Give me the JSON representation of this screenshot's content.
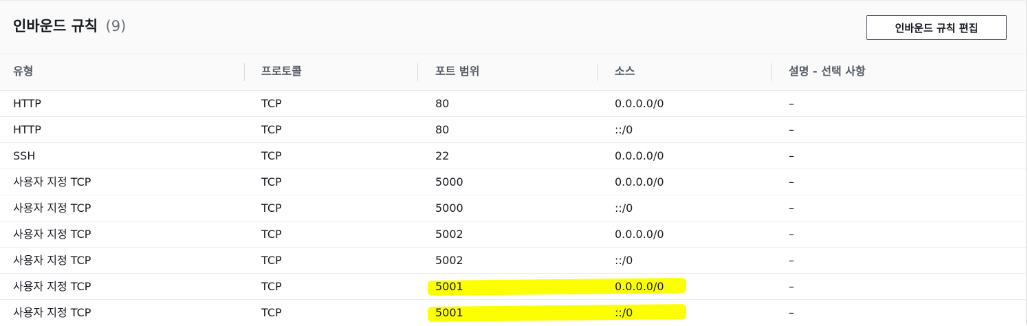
{
  "header": {
    "title": "인바운드 규칙",
    "count": "(9)",
    "edit_button_label": "인바운드 규칙 편집"
  },
  "table": {
    "columns": [
      "유형",
      "프로토콜",
      "포트 범위",
      "소스",
      "설명 - 선택 사항"
    ],
    "rows": [
      {
        "type": "HTTP",
        "protocol": "TCP",
        "port": "80",
        "source": "0.0.0.0/0",
        "description": "–",
        "highlighted": false
      },
      {
        "type": "HTTP",
        "protocol": "TCP",
        "port": "80",
        "source": "::/0",
        "description": "–",
        "highlighted": false
      },
      {
        "type": "SSH",
        "protocol": "TCP",
        "port": "22",
        "source": "0.0.0.0/0",
        "description": "–",
        "highlighted": false
      },
      {
        "type": "사용자 지정 TCP",
        "protocol": "TCP",
        "port": "5000",
        "source": "0.0.0.0/0",
        "description": "–",
        "highlighted": false
      },
      {
        "type": "사용자 지정 TCP",
        "protocol": "TCP",
        "port": "5000",
        "source": "::/0",
        "description": "–",
        "highlighted": false
      },
      {
        "type": "사용자 지정 TCP",
        "protocol": "TCP",
        "port": "5002",
        "source": "0.0.0.0/0",
        "description": "–",
        "highlighted": false
      },
      {
        "type": "사용자 지정 TCP",
        "protocol": "TCP",
        "port": "5002",
        "source": "::/0",
        "description": "–",
        "highlighted": false
      },
      {
        "type": "사용자 지정 TCP",
        "protocol": "TCP",
        "port": "5001",
        "source": "0.0.0.0/0",
        "description": "–",
        "highlighted": true
      },
      {
        "type": "사용자 지정 TCP",
        "protocol": "TCP",
        "port": "5001",
        "source": "::/0",
        "description": "–",
        "highlighted": true
      }
    ]
  },
  "colors": {
    "highlight": "#fbff00",
    "header_bg": "#fafafa",
    "border": "#eaeded",
    "text": "#16191f",
    "muted_text": "#545b64"
  }
}
